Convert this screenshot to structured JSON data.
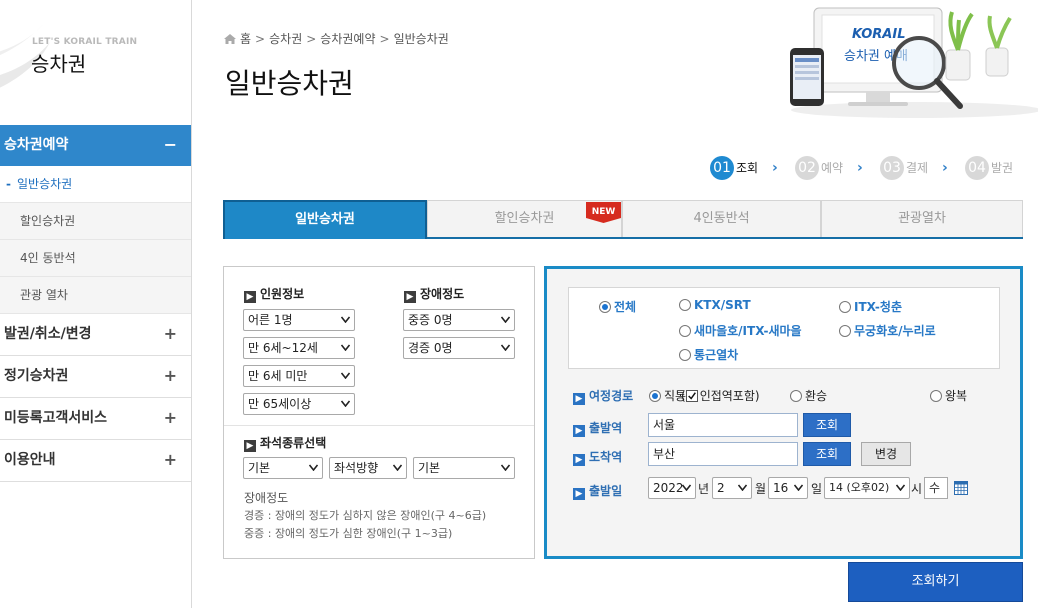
{
  "sidebar": {
    "eng_title": "LET'S KORAIL TRAIN",
    "title": "승차권",
    "menus": [
      {
        "label": "승차권예약",
        "symbol": "−"
      },
      {
        "label": "발권/취소/변경",
        "symbol": "+"
      },
      {
        "label": "정기승차권",
        "symbol": "+"
      },
      {
        "label": "미등록고객서비스",
        "symbol": "+"
      },
      {
        "label": "이용안내",
        "symbol": "+"
      }
    ],
    "submenu": [
      {
        "label": "일반승차권",
        "marker": "-"
      },
      {
        "label": "할인승차권"
      },
      {
        "label": "4인 동반석"
      },
      {
        "label": "관광 열차"
      }
    ]
  },
  "breadcrumb": [
    "홈",
    "승차권",
    "승차권예약",
    "일반승차권"
  ],
  "breadcrumb_sep": ">",
  "page_title": "일반승차권",
  "hero": {
    "logo": "KORAIL",
    "text": "승차권 예매"
  },
  "steps": [
    {
      "num": "01",
      "label": "조회"
    },
    {
      "num": "02",
      "label": "예약"
    },
    {
      "num": "03",
      "label": "결제"
    },
    {
      "num": "04",
      "label": "발권"
    }
  ],
  "step_arrow": "›",
  "tabs": [
    "일반승차권",
    "할인승차권",
    "4인동반석",
    "관광열차"
  ],
  "new_badge": "NEW",
  "passengers": {
    "label": "인원정보",
    "adult": "어른 1명",
    "child": "만 6세~12세",
    "infant": "만 6세 미만",
    "senior": "만 65세이상"
  },
  "disability": {
    "label": "장애정도",
    "severe": "중증 0명",
    "mild": "경증 0명"
  },
  "seat_type": {
    "label": "좌석종류선택",
    "options": [
      "기본",
      "좌석방향",
      "기본"
    ]
  },
  "notes": {
    "title": "장애정도",
    "line1": "경증 : 장애의 정도가 심하지 않은 장애인(구 4~6급)",
    "line2": "중증 : 장애의 정도가 심한 장애인(구 1~3급)"
  },
  "train_types": [
    "전체",
    "KTX/SRT",
    "ITX-청춘",
    "새마을호/ITX-새마을",
    "무궁화호/누리로",
    "통근열차"
  ],
  "route": {
    "label": "여정경로",
    "direct": "직통",
    "nearby": "인접역포함",
    "transfer": "환승",
    "roundtrip": "왕복"
  },
  "departure": {
    "label": "출발역",
    "value": "서울",
    "button": "조회"
  },
  "arrival": {
    "label": "도착역",
    "value": "부산",
    "button": "조회",
    "swap": "변경"
  },
  "date": {
    "label": "출발일",
    "year": "2022",
    "year_unit": "년",
    "month": "2",
    "month_unit": "월",
    "day": "16",
    "day_unit": "일",
    "hour": "14 (오후02)",
    "hour_unit": "시",
    "weekday": "수"
  },
  "submit": "조회하기",
  "colors": {
    "primary": "#1e88c7",
    "sidebar_active": "#2f87cb",
    "submit": "#1d5fc0",
    "new_badge": "#d62b1f"
  }
}
